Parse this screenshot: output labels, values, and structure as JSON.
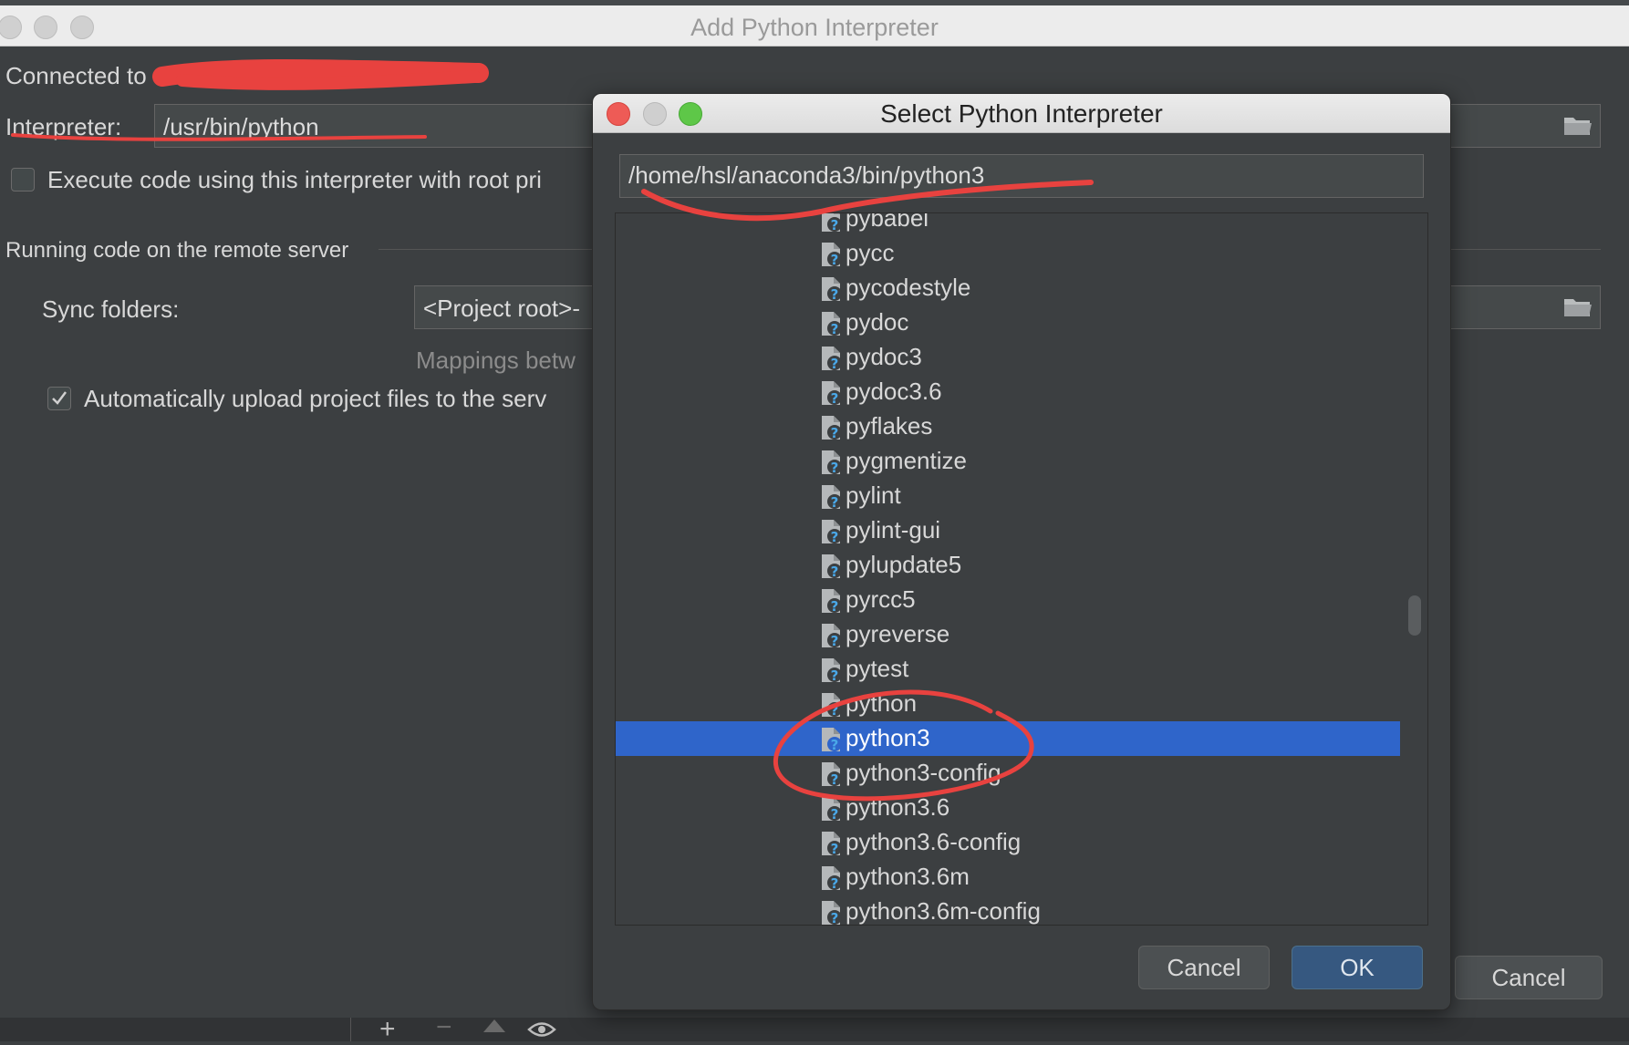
{
  "outer_window": {
    "title": "Add Python Interpreter",
    "connected_label": "Connected to",
    "interpreter_label": "Interpreter:",
    "interpreter_value": "/usr/bin/python",
    "execute_root_label": "Execute code using this interpreter with root pri",
    "section_label": "Running code on the remote server",
    "sync_folders_label": "Sync folders:",
    "sync_folders_value": "<Project root>-",
    "mappings_hint": "Mappings betw",
    "auto_upload_label": "Automatically upload project files to the serv",
    "auto_upload_checked": true,
    "cancel_label": "Cancel"
  },
  "dialog": {
    "title": "Select Python Interpreter",
    "path_value": "/home/hsl/anaconda3/bin/python3",
    "files": [
      {
        "name": "pybabel",
        "selected": false
      },
      {
        "name": "pycc",
        "selected": false
      },
      {
        "name": "pycodestyle",
        "selected": false
      },
      {
        "name": "pydoc",
        "selected": false
      },
      {
        "name": "pydoc3",
        "selected": false
      },
      {
        "name": "pydoc3.6",
        "selected": false
      },
      {
        "name": "pyflakes",
        "selected": false
      },
      {
        "name": "pygmentize",
        "selected": false
      },
      {
        "name": "pylint",
        "selected": false
      },
      {
        "name": "pylint-gui",
        "selected": false
      },
      {
        "name": "pylupdate5",
        "selected": false
      },
      {
        "name": "pyrcc5",
        "selected": false
      },
      {
        "name": "pyreverse",
        "selected": false
      },
      {
        "name": "pytest",
        "selected": false
      },
      {
        "name": "python",
        "selected": false
      },
      {
        "name": "python3",
        "selected": true
      },
      {
        "name": "python3-config",
        "selected": false
      },
      {
        "name": "python3.6",
        "selected": false
      },
      {
        "name": "python3.6-config",
        "selected": false
      },
      {
        "name": "python3.6m",
        "selected": false
      },
      {
        "name": "python3.6m-config",
        "selected": false
      }
    ],
    "cancel_label": "Cancel",
    "ok_label": "OK"
  },
  "colors": {
    "background": "#3c3f41",
    "selection": "#2f65ca",
    "annotation_red": "#e8423f",
    "ok_button": "#365880"
  }
}
